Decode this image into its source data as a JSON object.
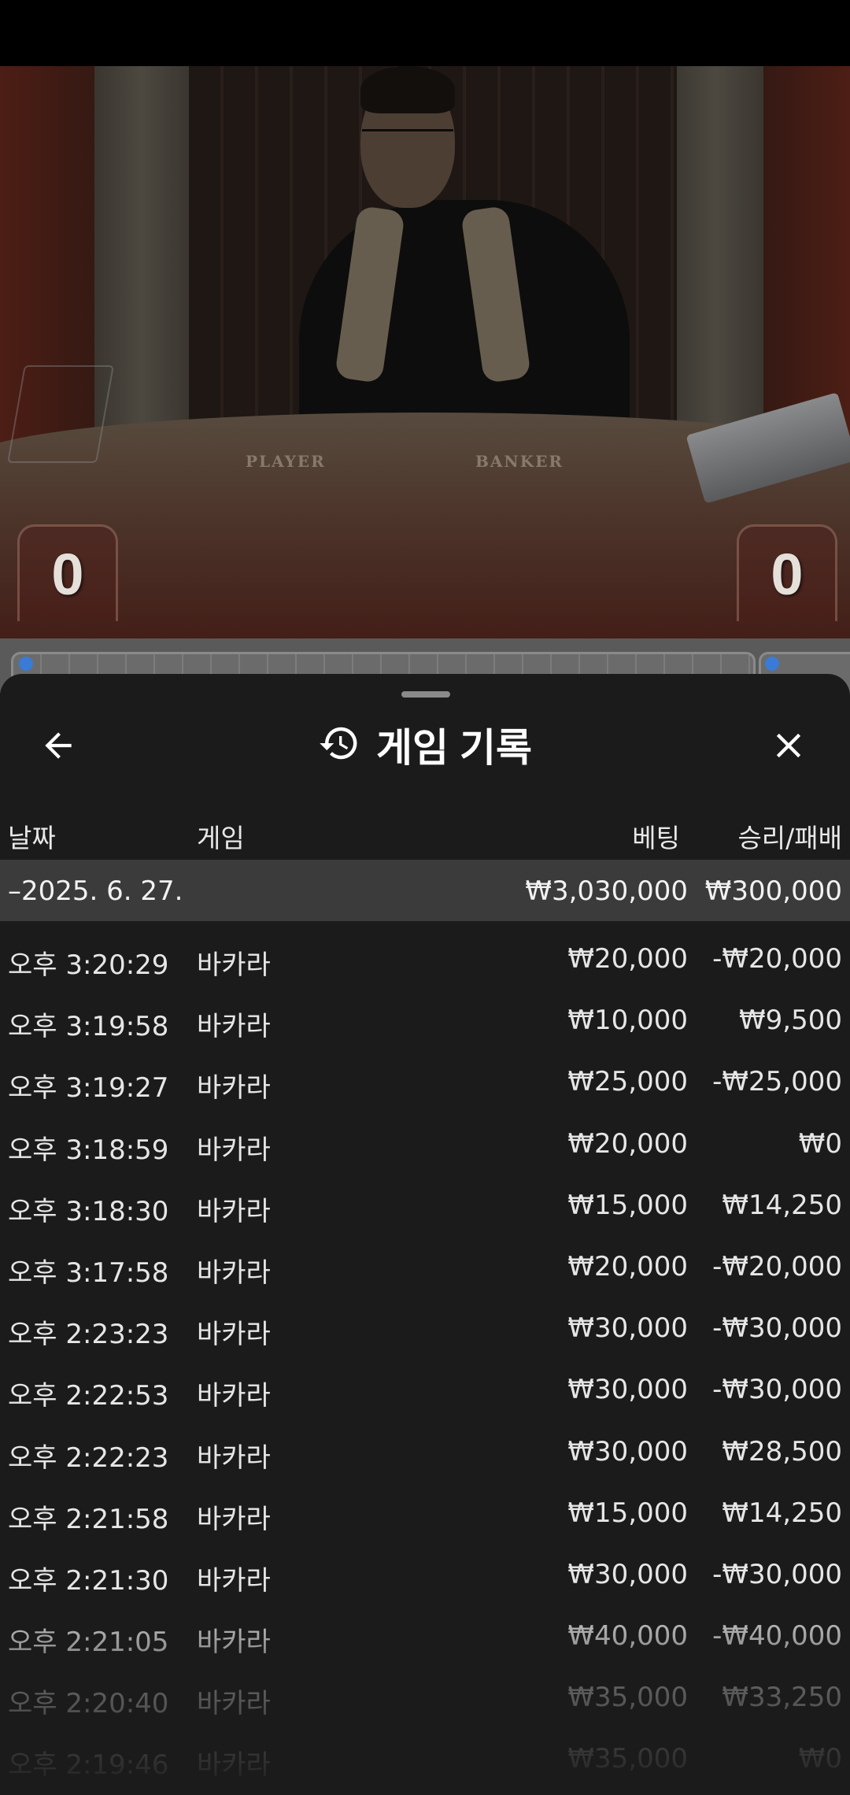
{
  "video": {
    "table_labels": {
      "player": "PLAYER",
      "banker": "BANKER"
    },
    "scores": {
      "player": "0",
      "banker": "0"
    }
  },
  "sheet": {
    "title": "게임 기록",
    "icons": {
      "back": "arrow-left-icon",
      "history": "history-icon",
      "close": "close-icon"
    },
    "columns": {
      "date": "날짜",
      "game": "게임",
      "bet": "베팅",
      "result": "승리/패배"
    },
    "group": {
      "date": "–2025. 6. 27.",
      "bet_total": "₩3,030,000",
      "result_total": "₩300,000"
    },
    "rows": [
      {
        "time": "오후 3:20:29",
        "game": "바카라",
        "bet": "₩20,000",
        "result": "-₩20,000"
      },
      {
        "time": "오후 3:19:58",
        "game": "바카라",
        "bet": "₩10,000",
        "result": "₩9,500"
      },
      {
        "time": "오후 3:19:27",
        "game": "바카라",
        "bet": "₩25,000",
        "result": "-₩25,000"
      },
      {
        "time": "오후 3:18:59",
        "game": "바카라",
        "bet": "₩20,000",
        "result": "₩0"
      },
      {
        "time": "오후 3:18:30",
        "game": "바카라",
        "bet": "₩15,000",
        "result": "₩14,250"
      },
      {
        "time": "오후 3:17:58",
        "game": "바카라",
        "bet": "₩20,000",
        "result": "-₩20,000"
      },
      {
        "time": "오후 2:23:23",
        "game": "바카라",
        "bet": "₩30,000",
        "result": "-₩30,000"
      },
      {
        "time": "오후 2:22:53",
        "game": "바카라",
        "bet": "₩30,000",
        "result": "-₩30,000"
      },
      {
        "time": "오후 2:22:23",
        "game": "바카라",
        "bet": "₩30,000",
        "result": "₩28,500"
      },
      {
        "time": "오후 2:21:58",
        "game": "바카라",
        "bet": "₩15,000",
        "result": "₩14,250"
      },
      {
        "time": "오후 2:21:30",
        "game": "바카라",
        "bet": "₩30,000",
        "result": "-₩30,000"
      },
      {
        "time": "오후 2:21:05",
        "game": "바카라",
        "bet": "₩40,000",
        "result": "-₩40,000"
      },
      {
        "time": "오후 2:20:40",
        "game": "바카라",
        "bet": "₩35,000",
        "result": "₩33,250"
      },
      {
        "time": "오후 2:19:46",
        "game": "바카라",
        "bet": "₩35,000",
        "result": "₩0"
      }
    ]
  }
}
